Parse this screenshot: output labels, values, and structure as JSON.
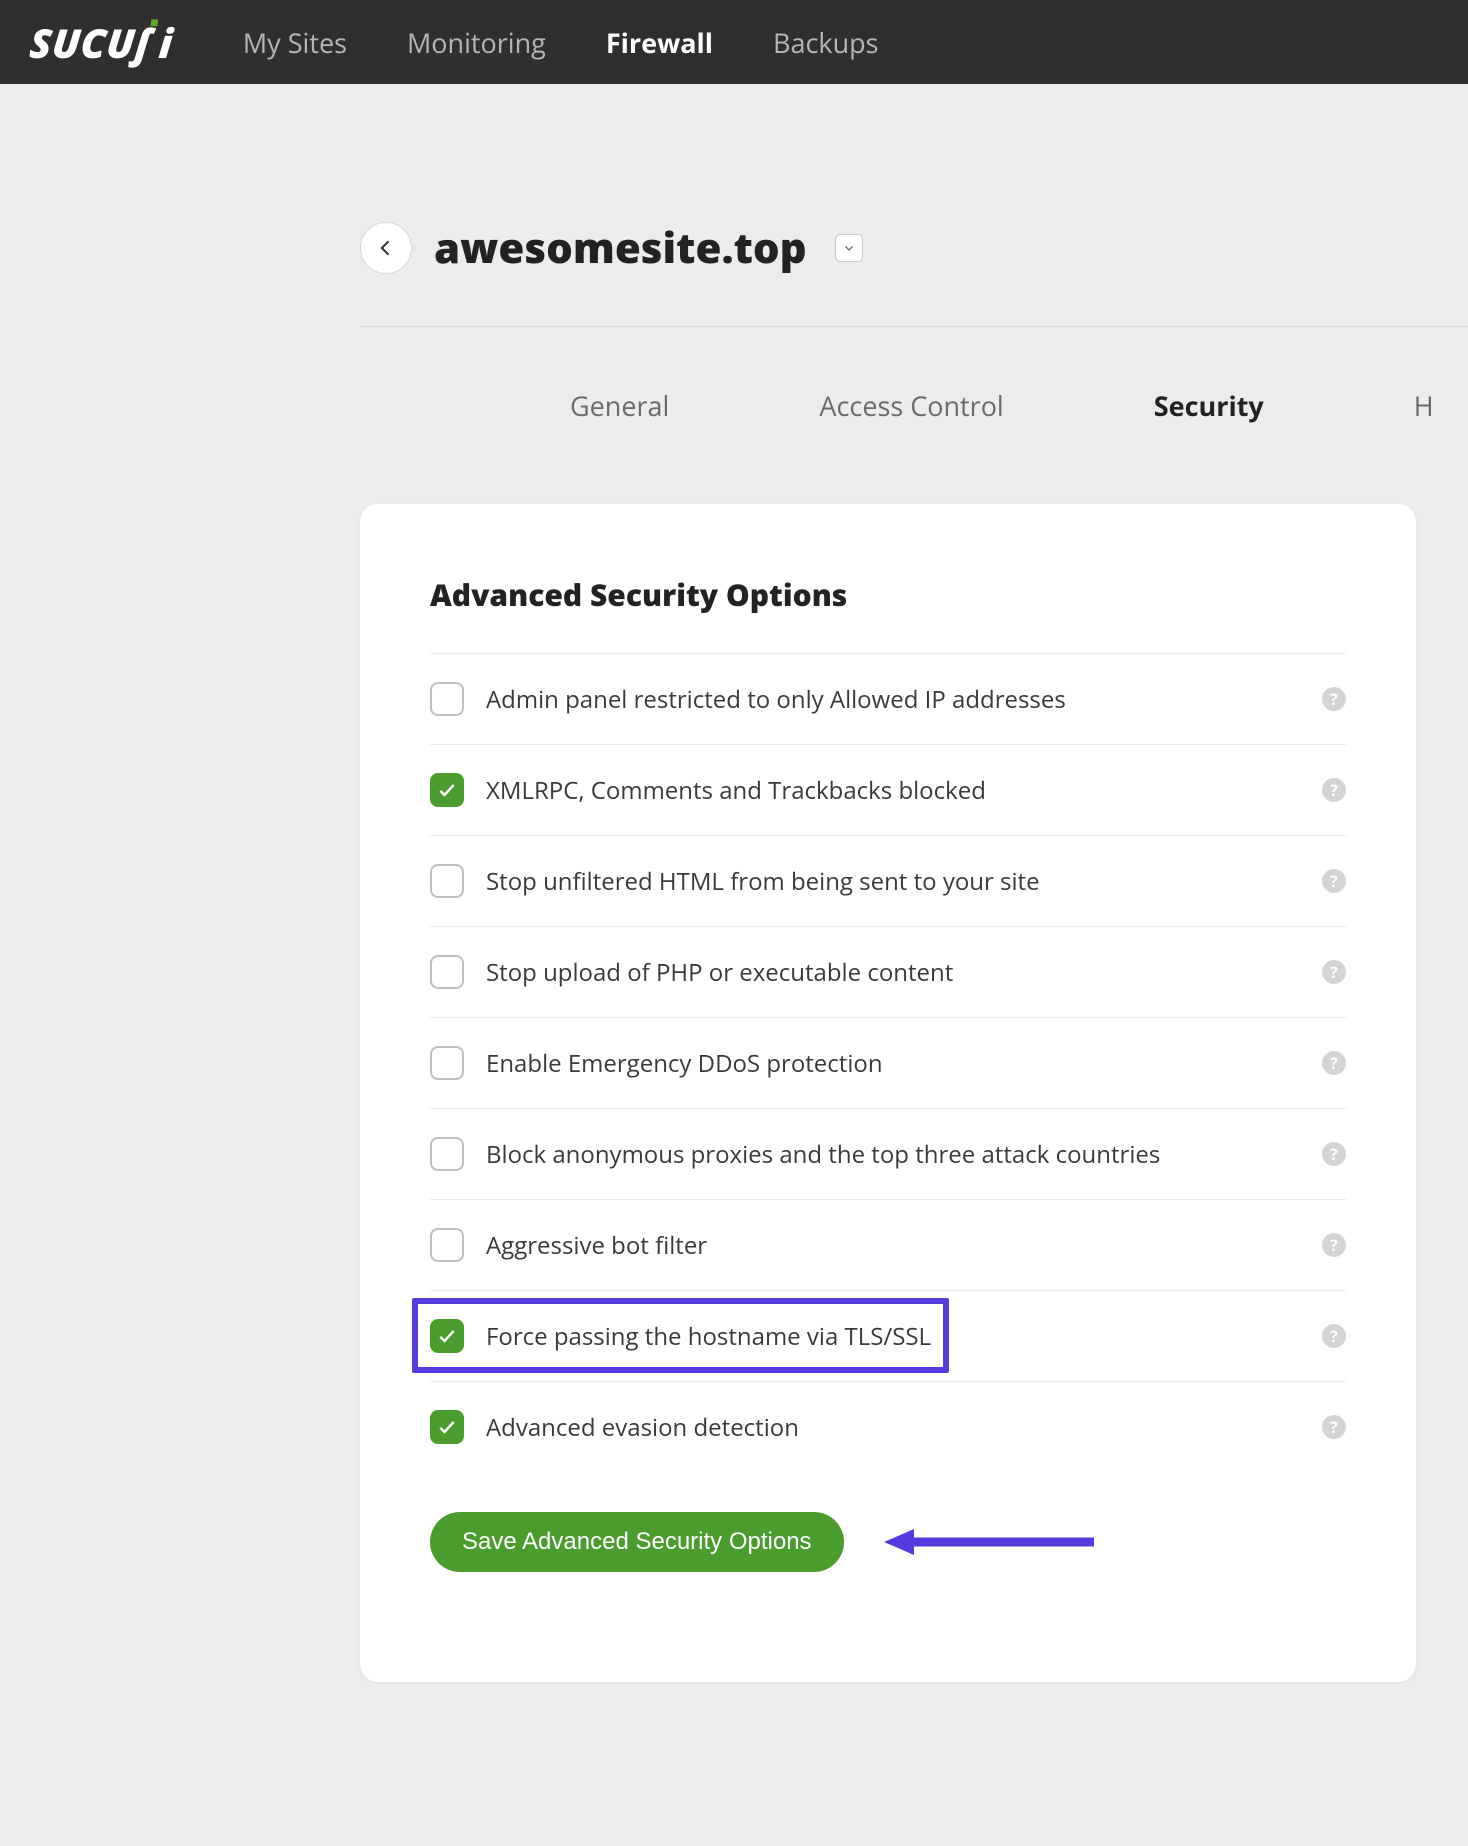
{
  "brand": "SUCURI",
  "nav": {
    "items": [
      {
        "label": "My Sites",
        "active": false
      },
      {
        "label": "Monitoring",
        "active": false
      },
      {
        "label": "Firewall",
        "active": true
      },
      {
        "label": "Backups",
        "active": false
      }
    ]
  },
  "site": {
    "name": "awesomesite.top"
  },
  "tabs": {
    "items": [
      {
        "label": "General",
        "active": false
      },
      {
        "label": "Access Control",
        "active": false
      },
      {
        "label": "Security",
        "active": true
      },
      {
        "label": "H",
        "active": false
      }
    ]
  },
  "card": {
    "title": "Advanced Security Options",
    "options": [
      {
        "label": "Admin panel restricted to only Allowed IP addresses",
        "checked": false
      },
      {
        "label": "XMLRPC, Comments and Trackbacks blocked",
        "checked": true
      },
      {
        "label": "Stop unfiltered HTML from being sent to your site",
        "checked": false
      },
      {
        "label": "Stop upload of PHP or executable content",
        "checked": false
      },
      {
        "label": "Enable Emergency DDoS protection",
        "checked": false
      },
      {
        "label": "Block anonymous proxies and the top three attack countries",
        "checked": false
      },
      {
        "label": "Aggressive bot filter",
        "checked": false
      },
      {
        "label": "Force passing the hostname via TLS/SSL",
        "checked": true,
        "highlighted": true
      },
      {
        "label": "Advanced evasion detection",
        "checked": true
      }
    ],
    "save_label": "Save Advanced Security Options"
  },
  "annotations": {
    "highlight_color": "#5739e0",
    "arrow_color": "#5739e0"
  }
}
